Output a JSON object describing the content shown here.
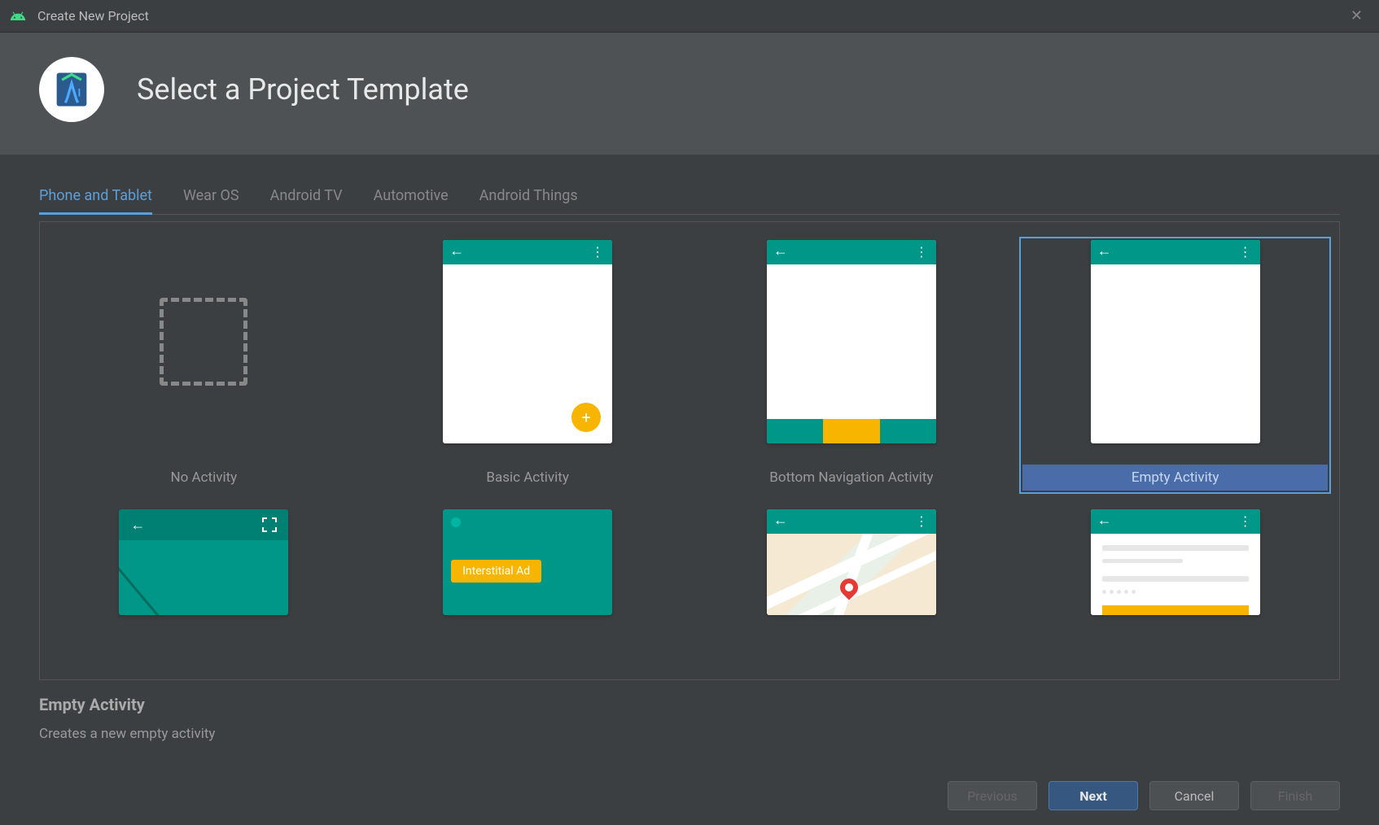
{
  "window": {
    "title": "Create New Project"
  },
  "header": {
    "title": "Select a Project Template"
  },
  "tabs": [
    {
      "label": "Phone and Tablet",
      "active": true
    },
    {
      "label": "Wear OS",
      "active": false
    },
    {
      "label": "Android TV",
      "active": false
    },
    {
      "label": "Automotive",
      "active": false
    },
    {
      "label": "Android Things",
      "active": false
    }
  ],
  "templates_row1": [
    {
      "label": "No Activity",
      "type": "none",
      "selected": false
    },
    {
      "label": "Basic Activity",
      "type": "basic",
      "selected": false
    },
    {
      "label": "Bottom Navigation Activity",
      "type": "bottomnav",
      "selected": false
    },
    {
      "label": "Empty Activity",
      "type": "empty",
      "selected": true
    }
  ],
  "templates_row2": [
    {
      "type": "fullscreen"
    },
    {
      "type": "interstitial",
      "badge": "Interstitial Ad"
    },
    {
      "type": "map"
    },
    {
      "type": "list"
    }
  ],
  "description": {
    "title": "Empty Activity",
    "text": "Creates a new empty activity"
  },
  "footer": {
    "previous": "Previous",
    "next": "Next",
    "cancel": "Cancel",
    "finish": "Finish"
  }
}
